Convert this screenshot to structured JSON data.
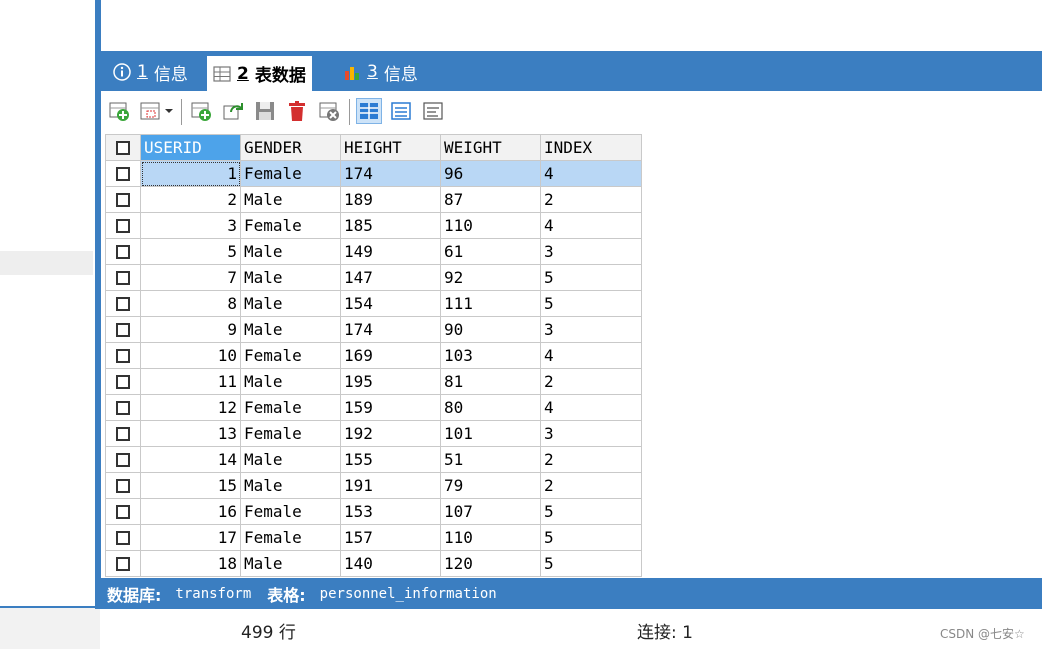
{
  "tabs": [
    {
      "num": "1",
      "label": "信息",
      "icon": "info-icon"
    },
    {
      "num": "2",
      "label": "表数据",
      "icon": "table-icon"
    },
    {
      "num": "3",
      "label": "信息",
      "icon": "chart-icon"
    }
  ],
  "toolbar": {
    "icons": [
      "insert-row-icon",
      "row-options-icon",
      "add-icon",
      "refresh-icon",
      "save-icon",
      "delete-icon",
      "remove-filter-icon",
      "grid-view-icon",
      "form-view-icon",
      "text-view-icon"
    ]
  },
  "grid": {
    "columns": [
      "USERID",
      "GENDER",
      "HEIGHT",
      "WEIGHT",
      "INDEX"
    ],
    "rows": [
      [
        "1",
        "Female",
        "174",
        "96",
        "4"
      ],
      [
        "2",
        "Male",
        "189",
        "87",
        "2"
      ],
      [
        "3",
        "Female",
        "185",
        "110",
        "4"
      ],
      [
        "5",
        "Male",
        "149",
        "61",
        "3"
      ],
      [
        "7",
        "Male",
        "147",
        "92",
        "5"
      ],
      [
        "8",
        "Male",
        "154",
        "111",
        "5"
      ],
      [
        "9",
        "Male",
        "174",
        "90",
        "3"
      ],
      [
        "10",
        "Female",
        "169",
        "103",
        "4"
      ],
      [
        "11",
        "Male",
        "195",
        "81",
        "2"
      ],
      [
        "12",
        "Female",
        "159",
        "80",
        "4"
      ],
      [
        "13",
        "Female",
        "192",
        "101",
        "3"
      ],
      [
        "14",
        "Male",
        "155",
        "51",
        "2"
      ],
      [
        "15",
        "Male",
        "191",
        "79",
        "2"
      ],
      [
        "16",
        "Female",
        "153",
        "107",
        "5"
      ],
      [
        "17",
        "Female",
        "157",
        "110",
        "5"
      ]
    ],
    "partial_row": [
      "18",
      "Male",
      "140",
      "120",
      "5"
    ]
  },
  "status": {
    "db_label": "数据库:",
    "db_value": "transform",
    "table_label": "表格:",
    "table_value": "personnel_information"
  },
  "footer": {
    "rows": "499 行",
    "connection": "连接: 1",
    "watermark": "CSDN @七安☆"
  },
  "colors": {
    "accent": "#3b7ec1",
    "selected_header": "#4da3ea",
    "selected_row": "#b9d7f5"
  }
}
